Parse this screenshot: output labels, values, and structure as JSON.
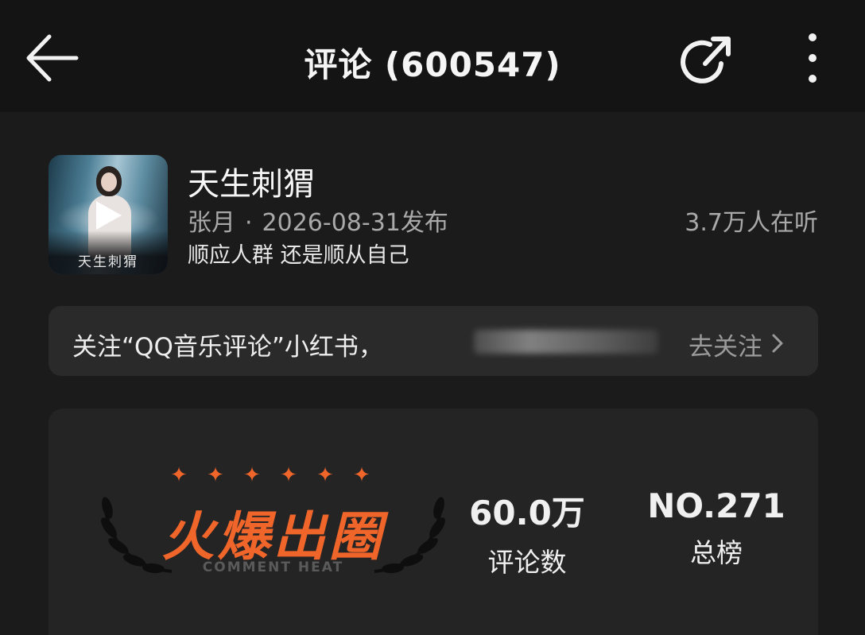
{
  "header": {
    "title": "评论 (600547)"
  },
  "song": {
    "title": "天生刺猬",
    "artist": "张月",
    "separator": "·",
    "release": "2026-08-31发布",
    "listeners": "3.7万人在听",
    "description": "顺应人群 还是顺从自己",
    "cover_text": "天生刺猬"
  },
  "notice": {
    "text": "关注“QQ音乐评论”小红书，",
    "action": "去关注"
  },
  "heat": {
    "badge_title": "火爆出圈",
    "badge_subtitle": "COMMENT HEAT",
    "comments_value": "60.0万",
    "comments_label": "评论数",
    "rank_value": "NO.271",
    "rank_label": "总榜",
    "accent_color": "#f0652a"
  },
  "icons": {
    "back": "arrow-left-icon",
    "share": "share-icon",
    "more": "more-vertical-icon",
    "play": "play-icon",
    "chevron": "chevron-right-icon",
    "star": "star-icon",
    "laurel": "laurel-icon"
  }
}
